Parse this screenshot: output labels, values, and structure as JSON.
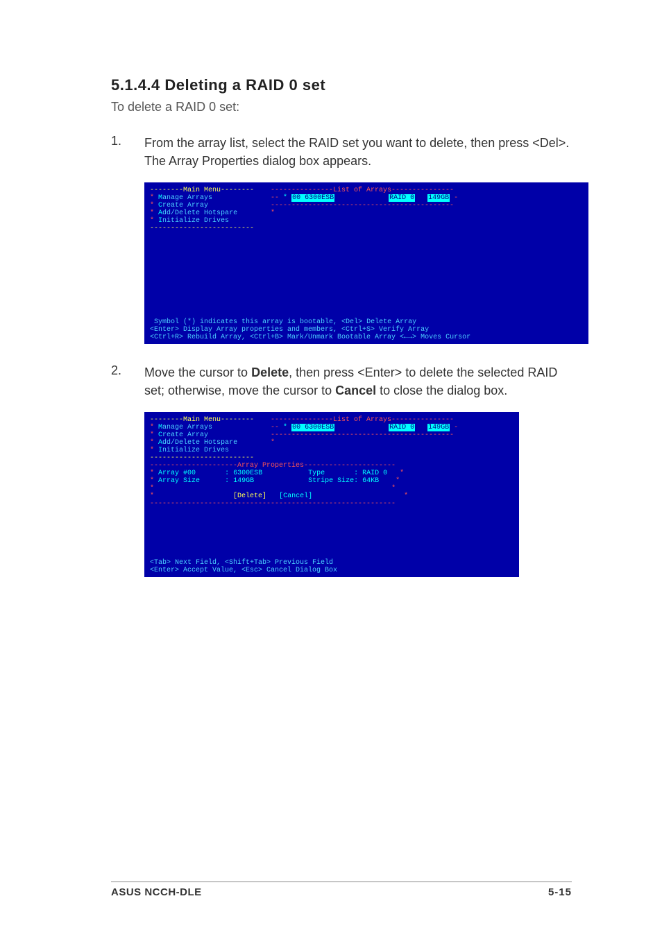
{
  "heading": "5.1.4.4 Deleting a RAID 0 set",
  "intro": "To delete a RAID 0 set:",
  "steps": [
    {
      "num": "1.",
      "text_pre": "From the array list, select the RAID set you want to delete, then press <Del>. The Array Properties dialog box appears."
    },
    {
      "num": "2.",
      "text_a": "Move the cursor to ",
      "bold_a": "Delete",
      "text_b": ", then press <Enter> to delete the selected RAID set; otherwise, move the cursor to ",
      "bold_b": "Cancel",
      "text_c": " to close the dialog box."
    }
  ],
  "bios1": {
    "menu_title": "--------Main Menu--------",
    "menu_items": [
      "Manage Arrays",
      "Create Array",
      "Add/Delete Hotspare",
      "Initialize Drives"
    ],
    "menu_border_bottom": "-------------------------",
    "list_title_line": "---------------List of Arrays---------------",
    "list_row_id": "00 6300ESB",
    "list_row_raid": "RAID 0",
    "list_row_size": "149GB",
    "list_border_bottom": "--------------------------------------------",
    "footer1": "Symbol (*) indicates this array is bootable, <Del> Delete Array",
    "footer2": "<Enter> Display Array properties and members, <Ctrl+S> Verify Array",
    "footer3": "<Ctrl+R> Rebuild Array, <Ctrl+B> Mark/Unmark Bootable Array <←→> Moves Cursor"
  },
  "bios2": {
    "menu_title": "--------Main Menu--------",
    "menu_items": [
      "Manage Arrays",
      "Create Array",
      "Add/Delete Hotspare",
      "Initialize Drives"
    ],
    "menu_border_bottom": "-------------------------",
    "list_title_line": "---------------List of Arrays---------------",
    "list_row_id": "00 6300ESB",
    "list_row_raid": "RAID 0",
    "list_row_size": "149GB",
    "list_border_bottom": "--------------------------------------------",
    "props_title": "---------------------Array Properties----------------------",
    "props": {
      "array_no_label": "Array #00",
      "array_no_val": ": 6300ESB",
      "type_label": "Type",
      "type_val": ": RAID 0",
      "size_label": "Array Size",
      "size_val": ": 149GB",
      "stripe_label": "Stripe Size:",
      "stripe_val": "64KB",
      "delete": "[Delete]",
      "cancel": "[Cancel]"
    },
    "props_border_bottom": "-----------------------------------------------------------",
    "footer1": "<Tab> Next Field, <Shift+Tab> Previous Field",
    "footer2": "<Enter> Accept Value, <Esc> Cancel Dialog Box"
  },
  "footer_left": "ASUS NCCH-DLE",
  "footer_right": "5-15"
}
